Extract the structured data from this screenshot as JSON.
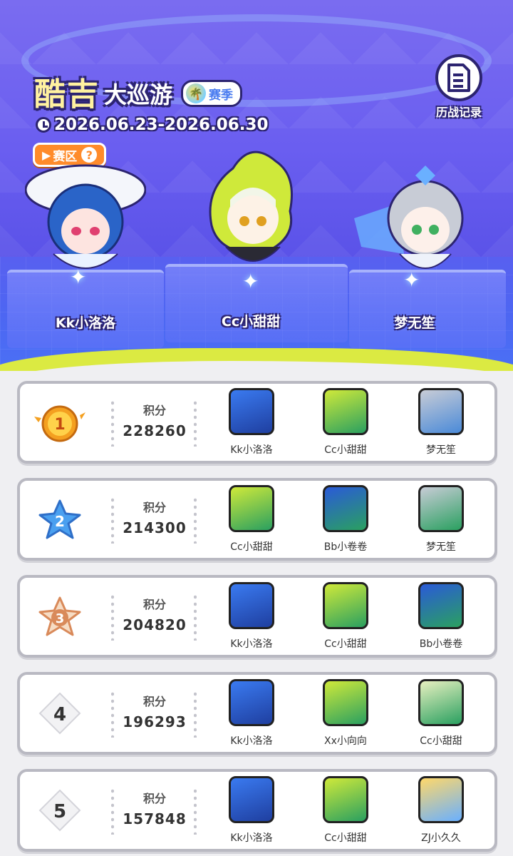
{
  "event": {
    "title_main": "酷吉",
    "title_sub": "大巡游",
    "season_label": "赛季",
    "date_range": "2026.06.23-2026.06.30",
    "zone_label": "赛区",
    "zone_help": "?",
    "history_label": "历战记录"
  },
  "podium": [
    {
      "name": "Kk小洛洛",
      "character": "blue-hair-girl"
    },
    {
      "name": "Cc小甜甜",
      "character": "green-hair-girl"
    },
    {
      "name": "梦无笙",
      "character": "silver-hair-girl"
    }
  ],
  "score_label": "积分",
  "rankings": [
    {
      "rank": "1",
      "score": "228260",
      "members": [
        "Kk小洛洛",
        "Cc小甜甜",
        "梦无笙"
      ]
    },
    {
      "rank": "2",
      "score": "214300",
      "members": [
        "Cc小甜甜",
        "Bb小卷卷",
        "梦无笙"
      ]
    },
    {
      "rank": "3",
      "score": "204820",
      "members": [
        "Kk小洛洛",
        "Cc小甜甜",
        "Bb小卷卷"
      ]
    },
    {
      "rank": "4",
      "score": "196293",
      "members": [
        "Kk小洛洛",
        "Xx小向向",
        "Cc小甜甜"
      ]
    },
    {
      "rank": "5",
      "score": "157848",
      "members": [
        "Kk小洛洛",
        "Cc小甜甜",
        "ZJ小久久"
      ]
    }
  ],
  "colors": {
    "gold": "#f4a020",
    "silver_blue": "#4aa0f0",
    "bronze": "#d98a5a",
    "slime": "#dbea42",
    "header_purple": "#6a5ef0"
  }
}
